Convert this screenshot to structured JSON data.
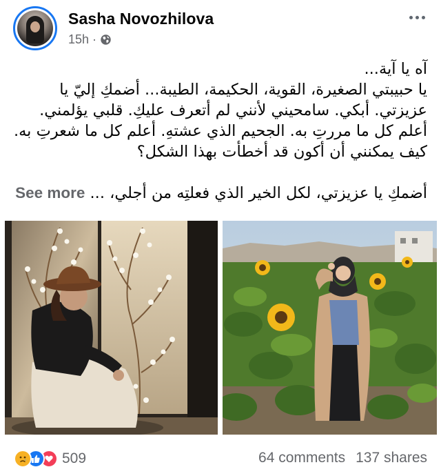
{
  "post": {
    "author": "Sasha Novozhilova",
    "time": "15h",
    "separator": "·",
    "privacy_icon": "globe-icon",
    "more_icon": "more-horizontal-icon",
    "text_lines": [
      "آه يا آية...",
      "يا حبيبتي الصغيرة، القوية، الحكيمة، الطيبة... أضمكِ إليّ يا عزيزتي. أبكي. سامحيني لأنني لم أتعرف عليكِ. قلبي يؤلمني. أعلم كل ما مررتِ به. الجحيم الذي عشتهِ. أعلم كل ما شعرتِ به. كيف يمكنني أن أكون قد أخطأت بهذا الشكل؟"
    ],
    "last_line": "أضمكِ يا عزيزتي، لكل الخير الذي فعلتِه من أجلي، ...",
    "see_more": "See more"
  },
  "photos": [
    {
      "icon": "photo-woman-hat-blossom-wall"
    },
    {
      "icon": "photo-woman-sunflower-field"
    }
  ],
  "footer": {
    "reaction_icons": [
      "sad-icon",
      "like-icon",
      "love-icon"
    ],
    "reaction_count": "509",
    "comments": "64 comments",
    "shares": "137 shares"
  },
  "colors": {
    "accent": "#1877f2",
    "muted": "#65676b",
    "sad": "#f7b125",
    "love": "#f33e58"
  }
}
